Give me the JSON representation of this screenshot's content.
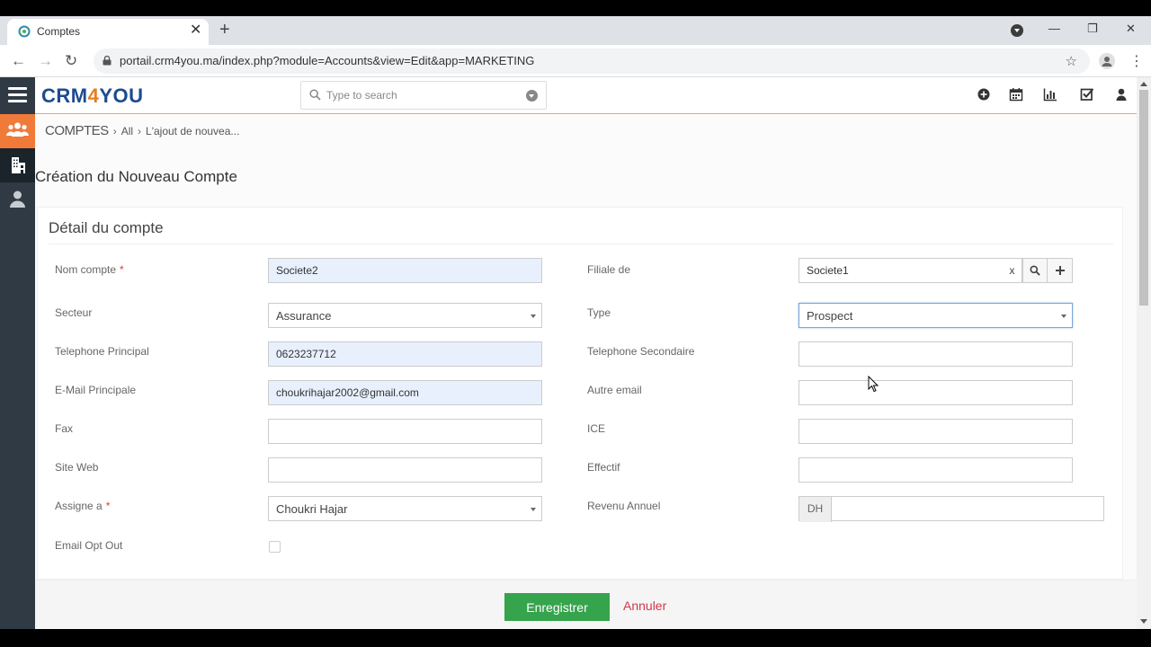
{
  "browser": {
    "tab_title": "Comptes",
    "url": "portail.crm4you.ma/index.php?module=Accounts&view=Edit&app=MARKETING"
  },
  "app": {
    "logo_left": "CRM",
    "logo_mid": "4",
    "logo_right": "YOU",
    "search_placeholder": "Type to search"
  },
  "breadcrumb": {
    "module": "COMPTES",
    "filter": "All",
    "current": "L'ajout de nouvea..."
  },
  "page_title": "Création du Nouveau Compte",
  "card_title": "Détail du compte",
  "fields": {
    "nom_compte": {
      "label": "Nom compte",
      "required": "*",
      "value": "Societe2"
    },
    "filiale": {
      "label": "Filiale de",
      "value": "Societe1",
      "clear": "x"
    },
    "secteur": {
      "label": "Secteur",
      "value": "Assurance"
    },
    "type": {
      "label": "Type",
      "value": "Prospect"
    },
    "tel_principal": {
      "label": "Telephone Principal",
      "value": "0623237712"
    },
    "tel_secondaire": {
      "label": "Telephone Secondaire",
      "value": ""
    },
    "email_principale": {
      "label": "E-Mail Principale",
      "value": "choukrihajar2002@gmail.com"
    },
    "autre_email": {
      "label": "Autre email",
      "value": ""
    },
    "fax": {
      "label": "Fax",
      "value": ""
    },
    "ice": {
      "label": "ICE",
      "value": ""
    },
    "site_web": {
      "label": "Site Web",
      "value": ""
    },
    "effectif": {
      "label": "Effectif",
      "value": ""
    },
    "assigne": {
      "label": "Assigne a",
      "required": "*",
      "value": "Choukri Hajar"
    },
    "revenu": {
      "label": "Revenu Annuel",
      "currency": "DH",
      "value": ""
    },
    "email_opt_out": {
      "label": "Email Opt Out",
      "checked": false
    }
  },
  "actions": {
    "save": "Enregistrer",
    "cancel": "Annuler"
  },
  "colors": {
    "sidebar": "#2f3a45",
    "accent_orange": "#f07a3a",
    "save_green": "#35a44c",
    "cancel_red": "#d0384a",
    "logo_blue": "#1d4b8f"
  }
}
